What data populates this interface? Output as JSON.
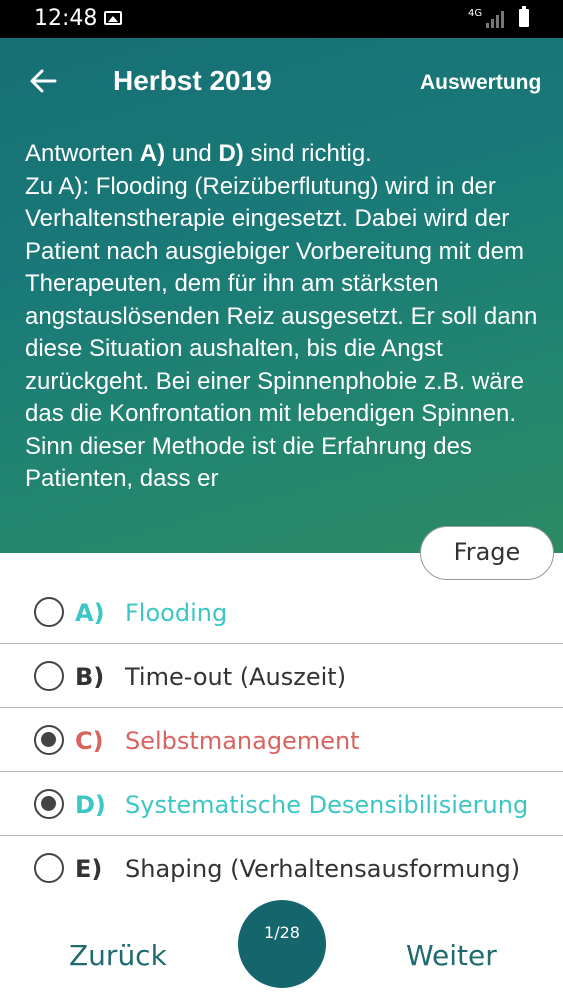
{
  "status_bar": {
    "time": "12:48",
    "network": "4G"
  },
  "header": {
    "title": "Herbst 2019",
    "action_label": "Auswertung"
  },
  "explanation": {
    "lead_1": "Antworten ",
    "lead_a": "A)",
    "lead_2": " und ",
    "lead_d": "D)",
    "lead_3": " sind richtig.",
    "body": "Zu A): Flooding (Reizüberflutung) wird in der Verhaltenstherapie eingesetzt. Dabei wird der Patient nach ausgiebiger Vorbereitung mit dem Therapeuten, dem für ihn am stärksten angstauslösenden Reiz ausgesetzt. Er soll dann diese Situation aushalten, bis die Angst zurückgeht. Bei einer Spinnenphobie z.B. wäre das die Konfrontation mit lebendigen Spinnen. Sinn dieser Methode ist die Erfahrung des Patienten, dass er"
  },
  "frage_button": "Frage",
  "options": [
    {
      "letter": "A)",
      "text": "Flooding",
      "selected": false,
      "status": "correct"
    },
    {
      "letter": "B)",
      "text": "Time-out (Auszeit)",
      "selected": false,
      "status": "neutral"
    },
    {
      "letter": "C)",
      "text": "Selbstmanagement",
      "selected": true,
      "status": "wrong"
    },
    {
      "letter": "D)",
      "text": "Systematische Desensibilisierung",
      "selected": true,
      "status": "correct"
    },
    {
      "letter": "E)",
      "text": "Shaping (Verhaltensausformung)",
      "selected": false,
      "status": "neutral"
    }
  ],
  "colors": {
    "correct": "#3cc6c6",
    "wrong": "#d9635f",
    "neutral": "#333333",
    "header_gradient_start": "#166f74",
    "header_gradient_end": "#2c8a64",
    "accent": "#1f6b6f"
  },
  "nav": {
    "back_label": "Zurück",
    "next_label": "Weiter",
    "counter": "1/28"
  }
}
